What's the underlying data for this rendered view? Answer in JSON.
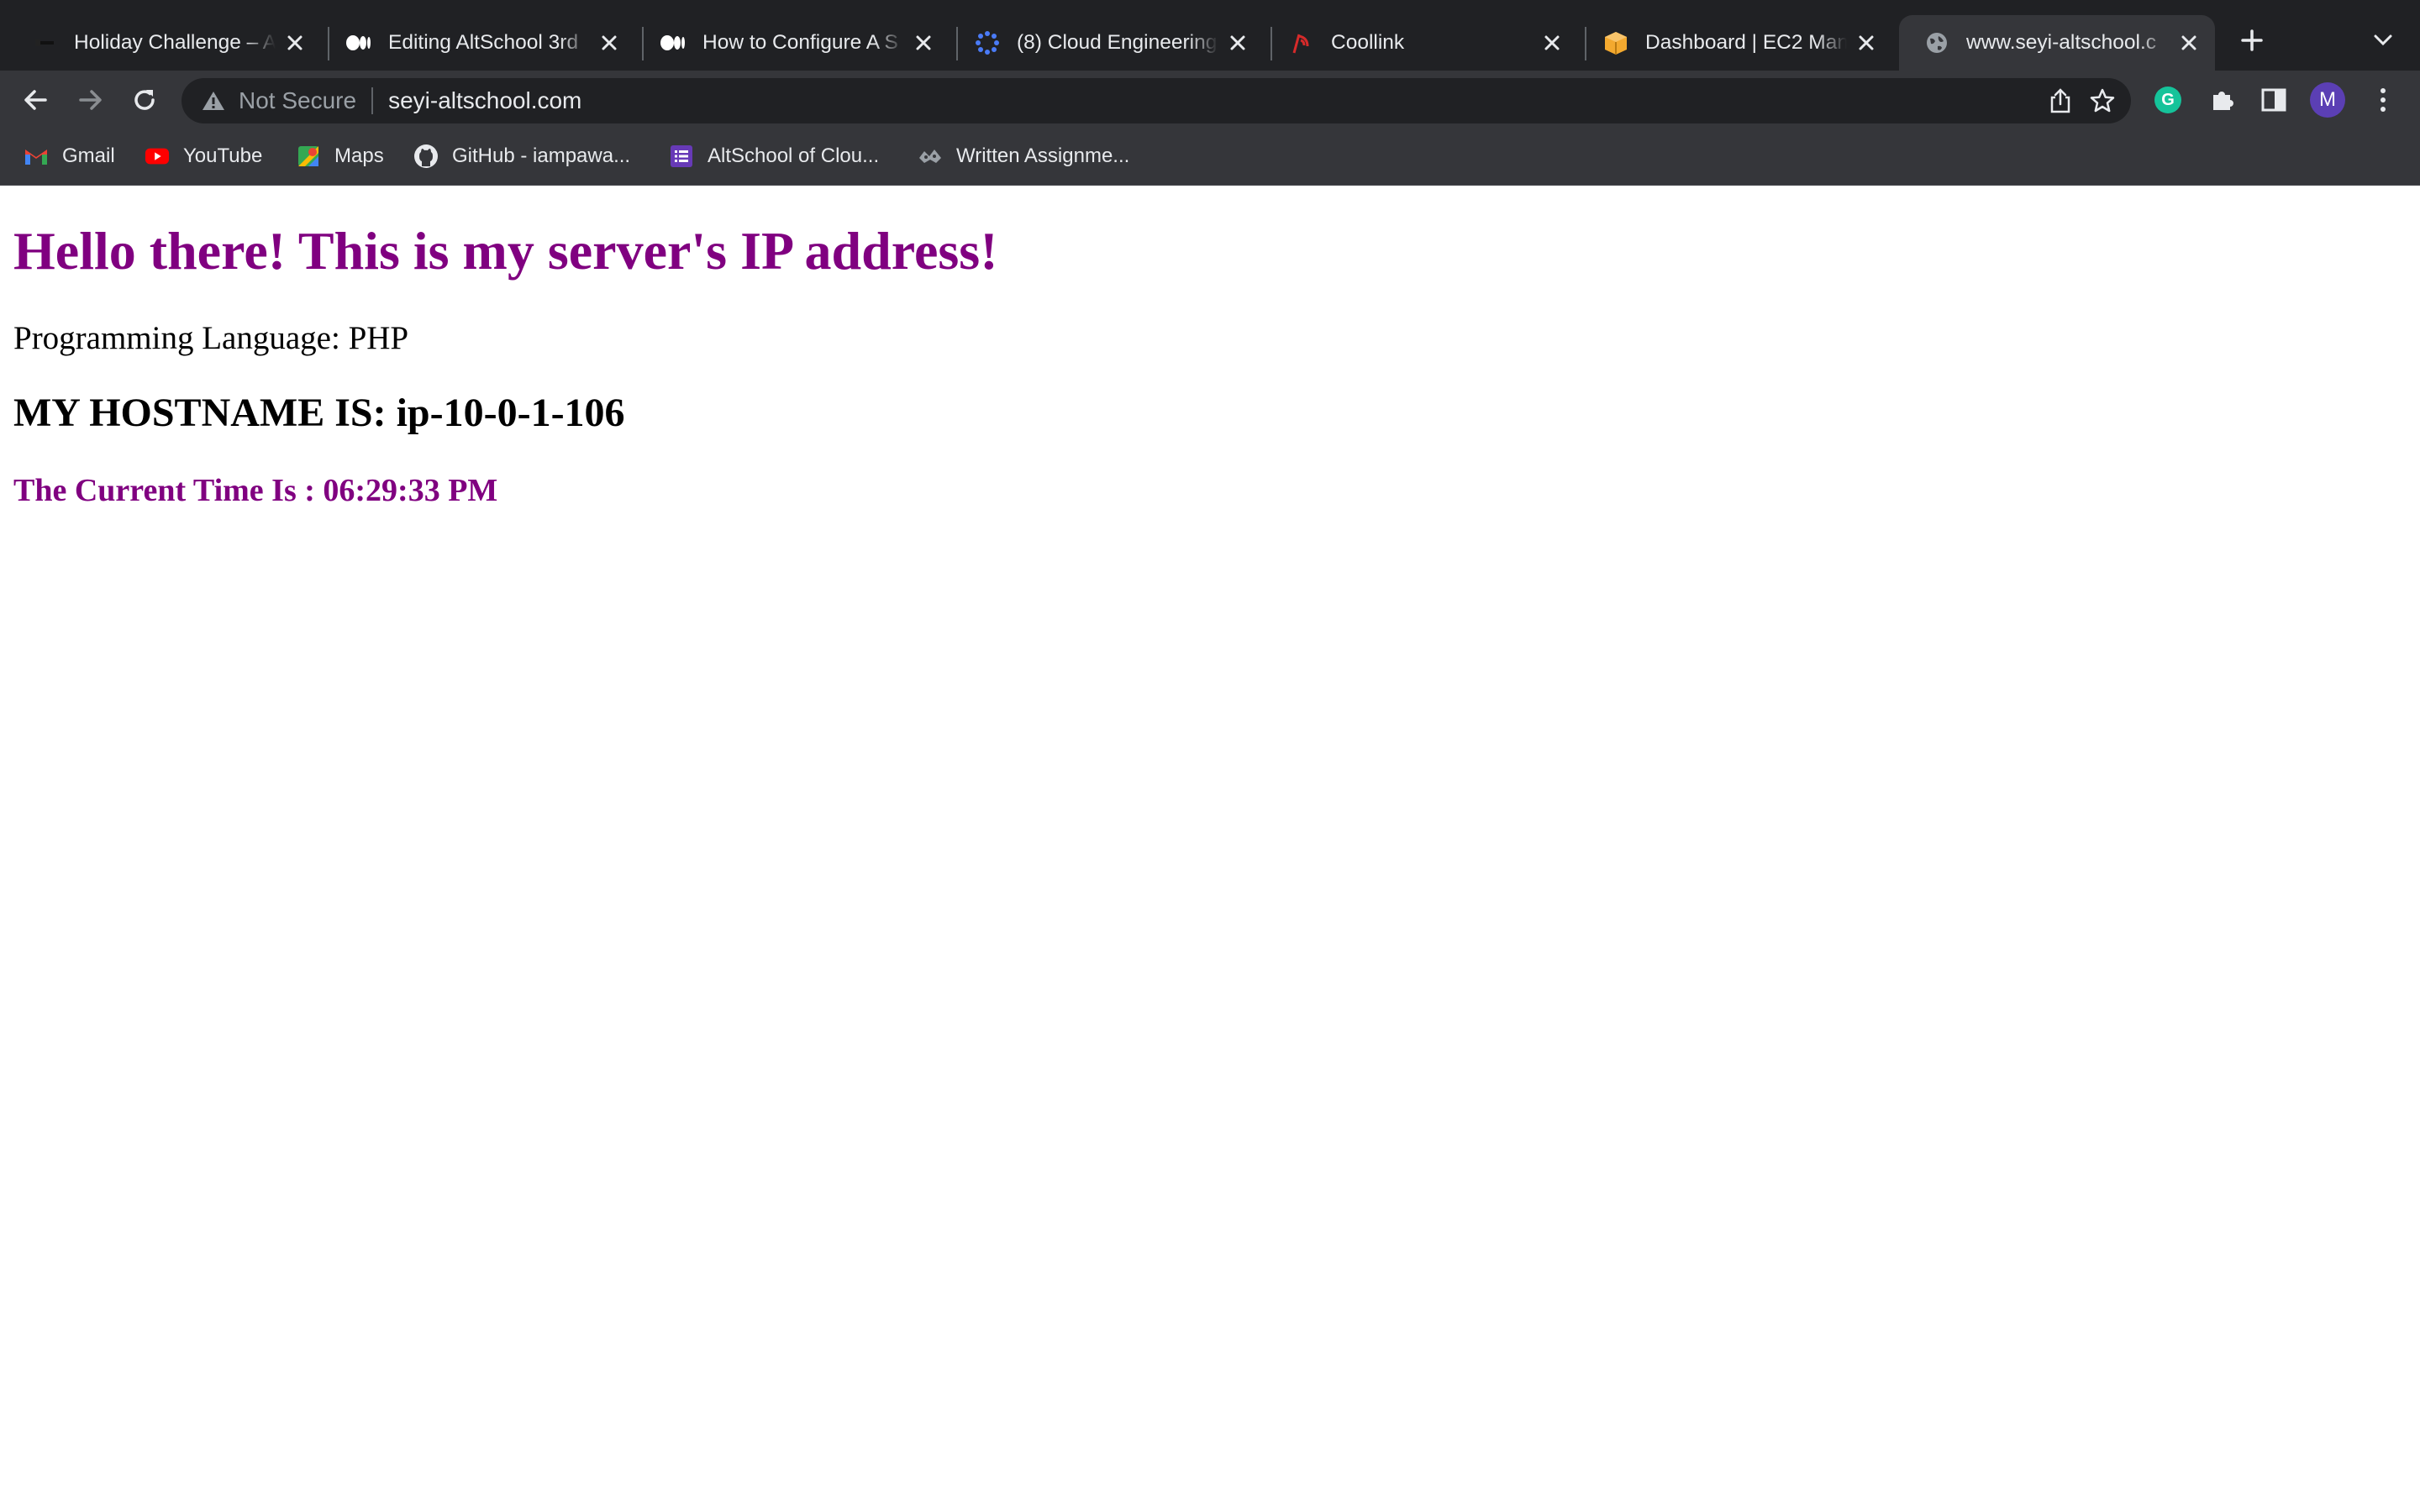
{
  "browser": {
    "tabs": [
      {
        "title": "Holiday Challenge – A",
        "favicon": "flag-icon",
        "active": false
      },
      {
        "title": "Editing AltSchool 3rd",
        "favicon": "medium-icon",
        "active": false
      },
      {
        "title": "How to Configure A S",
        "favicon": "medium-icon",
        "active": false
      },
      {
        "title": "(8) Cloud Engineering",
        "favicon": "circle-dots-icon",
        "active": false
      },
      {
        "title": "Coollink",
        "favicon": "signal-icon",
        "active": false
      },
      {
        "title": "Dashboard | EC2 Man",
        "favicon": "aws-box-icon",
        "active": false
      },
      {
        "title": "www.seyi-altschool.c",
        "favicon": "globe-icon",
        "active": true
      }
    ],
    "toolbar": {
      "security_label": "Not Secure",
      "url": "seyi-altschool.com",
      "profile_initial": "M",
      "extension_initial": "G"
    },
    "bookmarks": [
      {
        "label": "Gmail",
        "icon": "gmail-icon"
      },
      {
        "label": "YouTube",
        "icon": "youtube-icon"
      },
      {
        "label": "Maps",
        "icon": "maps-icon"
      },
      {
        "label": "GitHub - iampawa...",
        "icon": "github-icon"
      },
      {
        "label": "AltSchool of Clou...",
        "icon": "list-icon"
      },
      {
        "label": "Written Assignme...",
        "icon": "assignment-icon"
      }
    ],
    "colors": {
      "tab_strip": "#202124",
      "toolbar": "#35363a",
      "accent_purple": "#800080"
    }
  },
  "page": {
    "heading": "Hello there! This is my server's IP address!",
    "language_line": "Programming Language: PHP",
    "hostname_line": "MY HOSTNAME IS: ip-10-0-1-106",
    "time_line": "The Current Time Is : 06:29:33 PM"
  }
}
